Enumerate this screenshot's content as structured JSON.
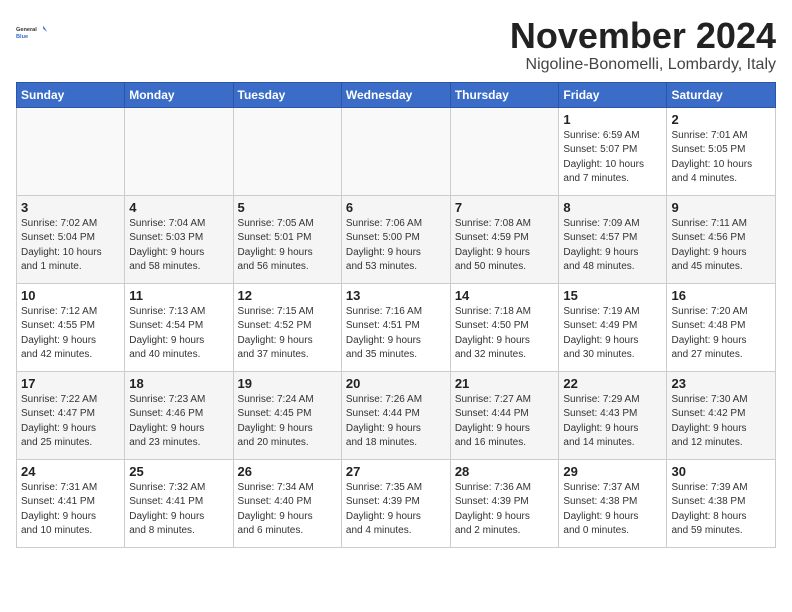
{
  "header": {
    "logo_line1": "General",
    "logo_line2": "Blue",
    "month": "November 2024",
    "location": "Nigoline-Bonomelli, Lombardy, Italy"
  },
  "days_of_week": [
    "Sunday",
    "Monday",
    "Tuesday",
    "Wednesday",
    "Thursday",
    "Friday",
    "Saturday"
  ],
  "weeks": [
    [
      {
        "day": "",
        "info": ""
      },
      {
        "day": "",
        "info": ""
      },
      {
        "day": "",
        "info": ""
      },
      {
        "day": "",
        "info": ""
      },
      {
        "day": "",
        "info": ""
      },
      {
        "day": "1",
        "info": "Sunrise: 6:59 AM\nSunset: 5:07 PM\nDaylight: 10 hours\nand 7 minutes."
      },
      {
        "day": "2",
        "info": "Sunrise: 7:01 AM\nSunset: 5:05 PM\nDaylight: 10 hours\nand 4 minutes."
      }
    ],
    [
      {
        "day": "3",
        "info": "Sunrise: 7:02 AM\nSunset: 5:04 PM\nDaylight: 10 hours\nand 1 minute."
      },
      {
        "day": "4",
        "info": "Sunrise: 7:04 AM\nSunset: 5:03 PM\nDaylight: 9 hours\nand 58 minutes."
      },
      {
        "day": "5",
        "info": "Sunrise: 7:05 AM\nSunset: 5:01 PM\nDaylight: 9 hours\nand 56 minutes."
      },
      {
        "day": "6",
        "info": "Sunrise: 7:06 AM\nSunset: 5:00 PM\nDaylight: 9 hours\nand 53 minutes."
      },
      {
        "day": "7",
        "info": "Sunrise: 7:08 AM\nSunset: 4:59 PM\nDaylight: 9 hours\nand 50 minutes."
      },
      {
        "day": "8",
        "info": "Sunrise: 7:09 AM\nSunset: 4:57 PM\nDaylight: 9 hours\nand 48 minutes."
      },
      {
        "day": "9",
        "info": "Sunrise: 7:11 AM\nSunset: 4:56 PM\nDaylight: 9 hours\nand 45 minutes."
      }
    ],
    [
      {
        "day": "10",
        "info": "Sunrise: 7:12 AM\nSunset: 4:55 PM\nDaylight: 9 hours\nand 42 minutes."
      },
      {
        "day": "11",
        "info": "Sunrise: 7:13 AM\nSunset: 4:54 PM\nDaylight: 9 hours\nand 40 minutes."
      },
      {
        "day": "12",
        "info": "Sunrise: 7:15 AM\nSunset: 4:52 PM\nDaylight: 9 hours\nand 37 minutes."
      },
      {
        "day": "13",
        "info": "Sunrise: 7:16 AM\nSunset: 4:51 PM\nDaylight: 9 hours\nand 35 minutes."
      },
      {
        "day": "14",
        "info": "Sunrise: 7:18 AM\nSunset: 4:50 PM\nDaylight: 9 hours\nand 32 minutes."
      },
      {
        "day": "15",
        "info": "Sunrise: 7:19 AM\nSunset: 4:49 PM\nDaylight: 9 hours\nand 30 minutes."
      },
      {
        "day": "16",
        "info": "Sunrise: 7:20 AM\nSunset: 4:48 PM\nDaylight: 9 hours\nand 27 minutes."
      }
    ],
    [
      {
        "day": "17",
        "info": "Sunrise: 7:22 AM\nSunset: 4:47 PM\nDaylight: 9 hours\nand 25 minutes."
      },
      {
        "day": "18",
        "info": "Sunrise: 7:23 AM\nSunset: 4:46 PM\nDaylight: 9 hours\nand 23 minutes."
      },
      {
        "day": "19",
        "info": "Sunrise: 7:24 AM\nSunset: 4:45 PM\nDaylight: 9 hours\nand 20 minutes."
      },
      {
        "day": "20",
        "info": "Sunrise: 7:26 AM\nSunset: 4:44 PM\nDaylight: 9 hours\nand 18 minutes."
      },
      {
        "day": "21",
        "info": "Sunrise: 7:27 AM\nSunset: 4:44 PM\nDaylight: 9 hours\nand 16 minutes."
      },
      {
        "day": "22",
        "info": "Sunrise: 7:29 AM\nSunset: 4:43 PM\nDaylight: 9 hours\nand 14 minutes."
      },
      {
        "day": "23",
        "info": "Sunrise: 7:30 AM\nSunset: 4:42 PM\nDaylight: 9 hours\nand 12 minutes."
      }
    ],
    [
      {
        "day": "24",
        "info": "Sunrise: 7:31 AM\nSunset: 4:41 PM\nDaylight: 9 hours\nand 10 minutes."
      },
      {
        "day": "25",
        "info": "Sunrise: 7:32 AM\nSunset: 4:41 PM\nDaylight: 9 hours\nand 8 minutes."
      },
      {
        "day": "26",
        "info": "Sunrise: 7:34 AM\nSunset: 4:40 PM\nDaylight: 9 hours\nand 6 minutes."
      },
      {
        "day": "27",
        "info": "Sunrise: 7:35 AM\nSunset: 4:39 PM\nDaylight: 9 hours\nand 4 minutes."
      },
      {
        "day": "28",
        "info": "Sunrise: 7:36 AM\nSunset: 4:39 PM\nDaylight: 9 hours\nand 2 minutes."
      },
      {
        "day": "29",
        "info": "Sunrise: 7:37 AM\nSunset: 4:38 PM\nDaylight: 9 hours\nand 0 minutes."
      },
      {
        "day": "30",
        "info": "Sunrise: 7:39 AM\nSunset: 4:38 PM\nDaylight: 8 hours\nand 59 minutes."
      }
    ]
  ]
}
